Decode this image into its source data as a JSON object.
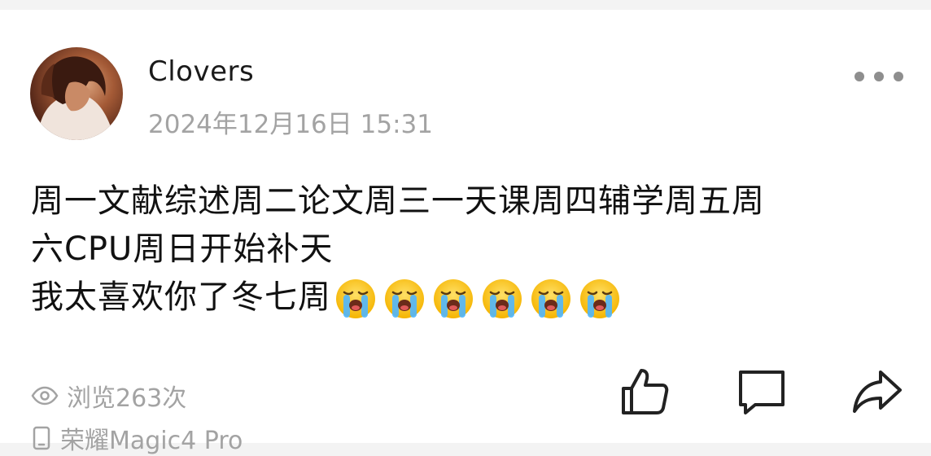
{
  "post": {
    "username": "Clovers",
    "timestamp": "2024年12月16日 15:31",
    "content_lines": [
      "周一文献综述周二论文周三一天课周四辅学周五周",
      "六CPU周日开始补天",
      "我太喜欢你了冬七周"
    ],
    "emoji": "loudly-crying-face",
    "emoji_count": 6
  },
  "meta": {
    "views_label": "浏览263次",
    "device_label": "荣耀Magic4 Pro"
  },
  "icons": {
    "more": "more-horizontal-icon",
    "view": "eye-icon",
    "device": "phone-icon",
    "like": "thumbs-up-icon",
    "comment": "comment-icon",
    "share": "share-icon"
  },
  "colors": {
    "background": "#f3f3f3",
    "card": "#ffffff",
    "primary_text": "#111111",
    "secondary_text": "#a3a3a3",
    "icon": "#222222"
  }
}
